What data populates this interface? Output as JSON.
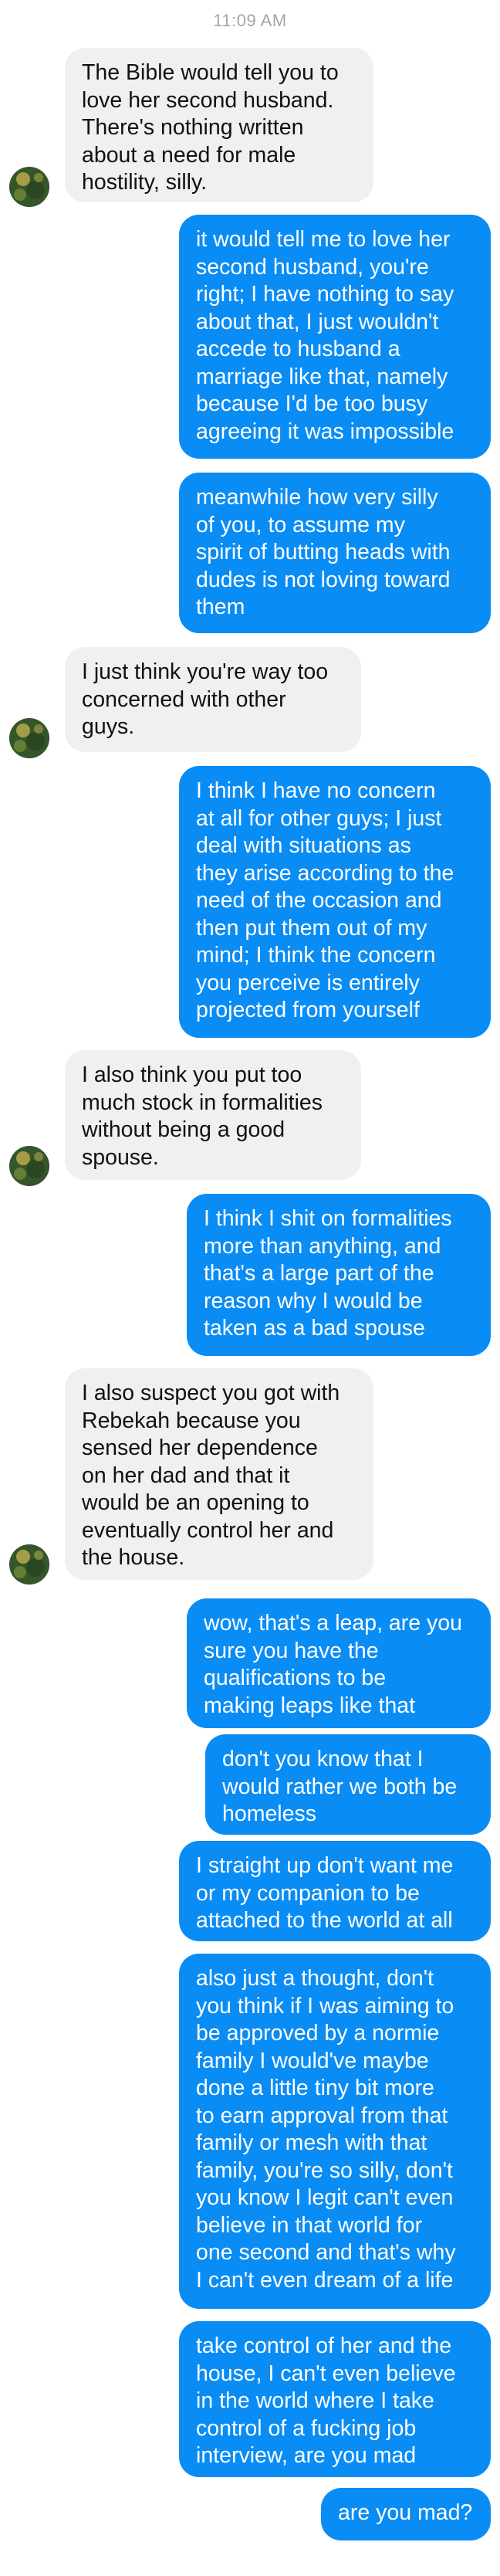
{
  "header": {
    "timestamp": "11:09 AM"
  },
  "messages": [
    {
      "direction": "incoming",
      "text": "The Bible would tell you to\nlove her second husband.\nThere's nothing written\nabout a need for male\nhostility, silly."
    },
    {
      "direction": "outgoing",
      "text": "it would tell me to love her\nsecond husband, you're\nright; I have nothing to say\nabout that, I just wouldn't\naccede to husband a\nmarriage like that, namely\nbecause I'd be too busy\nagreeing it was impossible"
    },
    {
      "direction": "outgoing",
      "text": "meanwhile how very silly\nof you, to assume my\nspirit of butting heads with\ndudes is not loving toward\nthem"
    },
    {
      "direction": "incoming",
      "text": "I just think you're way too\nconcerned with other\nguys."
    },
    {
      "direction": "outgoing",
      "text": "I think I have no concern\nat all for other guys; I just\ndeal with situations as\nthey arise according to the\nneed of the occasion and\nthen put them out of my\nmind; I think the concern\nyou perceive is entirely\nprojected from yourself"
    },
    {
      "direction": "incoming",
      "text": "I also think you put too\nmuch stock in formalities\nwithout being a good\nspouse."
    },
    {
      "direction": "outgoing",
      "text": "I think I shit on formalities\nmore than anything, and\nthat's a large part of the\nreason why I would be\ntaken as a bad spouse"
    },
    {
      "direction": "incoming",
      "text": "I also suspect you got with\nRebekah because you\nsensed her dependence\non her dad and that it\nwould be an opening to\neventually control her and\nthe house."
    },
    {
      "direction": "outgoing",
      "text": "wow, that's a leap, are you\nsure you have the\nqualifications to be\nmaking leaps like that"
    },
    {
      "direction": "outgoing",
      "text": "don't you know that I\nwould rather we both be\nhomeless"
    },
    {
      "direction": "outgoing",
      "text": "I straight up don't want me\nor my companion to be\nattached to the world at all"
    },
    {
      "direction": "outgoing",
      "text": "also just a thought, don't\nyou think if I was aiming to\nbe approved by a normie\nfamily I would've maybe\ndone a little tiny bit more\nto earn approval from that\nfamily or mesh with that\nfamily, you're so silly, don't\nyou know I legit can't even\nbelieve in that world for\none second and that's why\nI can't even dream of a life"
    },
    {
      "direction": "outgoing",
      "text": "take control of her and the\nhouse, I can't even believe\nin the world where I take\ncontrol of a fucking job\ninterview, are you mad"
    },
    {
      "direction": "outgoing",
      "text": "are you mad?"
    }
  ]
}
